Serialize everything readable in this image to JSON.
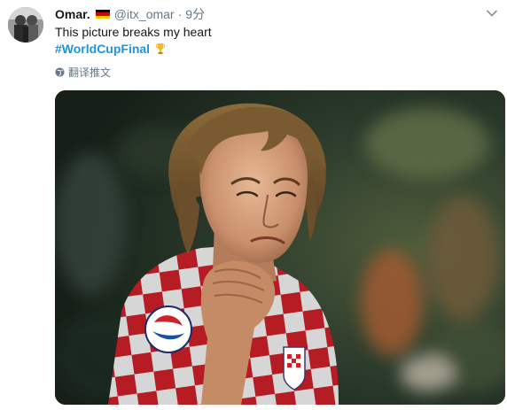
{
  "author": {
    "display_name": "Omar.",
    "flag_icon": "germany-flag-icon",
    "flag_colors": [
      "#000000",
      "#dd0000",
      "#ffce00"
    ],
    "handle": "@itx_omar",
    "separator": "·",
    "time": "9分"
  },
  "tweet": {
    "text_line1": "This picture breaks my heart",
    "hashtag": "#WorldCupFinal",
    "hashtag_emoji": "trophy-icon"
  },
  "translate": {
    "label": "翻译推文",
    "icon": "globe-icon"
  },
  "media": {
    "description_icon": "photo-crying-player"
  },
  "colors": {
    "link": "#1b95e0",
    "secondary_text": "#657786",
    "primary_text": "#14171a"
  }
}
